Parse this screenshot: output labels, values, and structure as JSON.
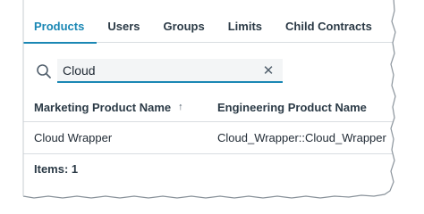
{
  "tabs": [
    {
      "label": "Products",
      "active": true
    },
    {
      "label": "Users",
      "active": false
    },
    {
      "label": "Groups",
      "active": false
    },
    {
      "label": "Limits",
      "active": false
    },
    {
      "label": "Child Contracts",
      "active": false
    }
  ],
  "search": {
    "value": "Cloud",
    "icon": "search-icon",
    "clear_icon": "close-icon"
  },
  "table": {
    "columns": [
      {
        "label": "Marketing Product Name",
        "sort": "ascending"
      },
      {
        "label": "Engineering Product Name"
      }
    ],
    "rows": [
      {
        "marketing": "Cloud Wrapper",
        "engineering": "Cloud_Wrapper::Cloud_Wrapper"
      }
    ],
    "footer": "Items: 1"
  },
  "colors": {
    "accent": "#1a87b4",
    "text": "#2b3a46",
    "divider": "#d9dde1"
  }
}
